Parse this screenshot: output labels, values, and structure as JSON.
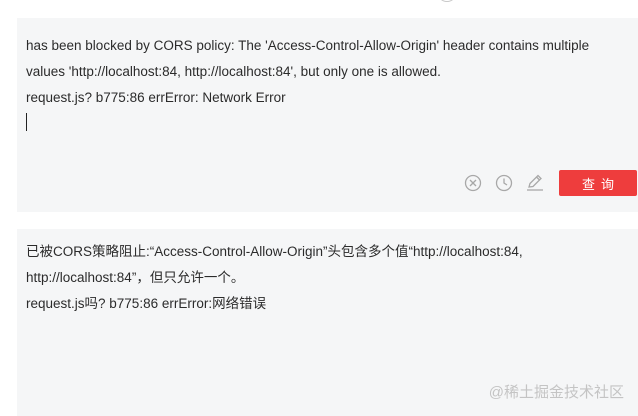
{
  "source": {
    "lines": [
      "has been blocked by CORS policy: The 'Access-Control-Allow-Origin' header contains multiple",
      "values 'http://localhost:84, http://localhost:84', but only one is allowed.",
      "request.js? b775:86 errError: Network Error"
    ]
  },
  "toolbar": {
    "clear_icon": "circle-x-icon",
    "history_icon": "clock-icon",
    "edit_icon": "pen-icon",
    "query_label": "查询"
  },
  "result": {
    "lines": [
      "已被CORS策略阻止:“Access-Control-Allow-Origin”头包含多个值“http://localhost:84,",
      "http://localhost:84”，但只允许一个。",
      "request.js吗? b775:86 errError:网络错误"
    ]
  },
  "watermark": "@稀土掘金技术社区",
  "colors": {
    "panel_bg": "#f5f6f7",
    "accent": "#ee3d3d",
    "icon_gray": "#a8a8a8"
  }
}
